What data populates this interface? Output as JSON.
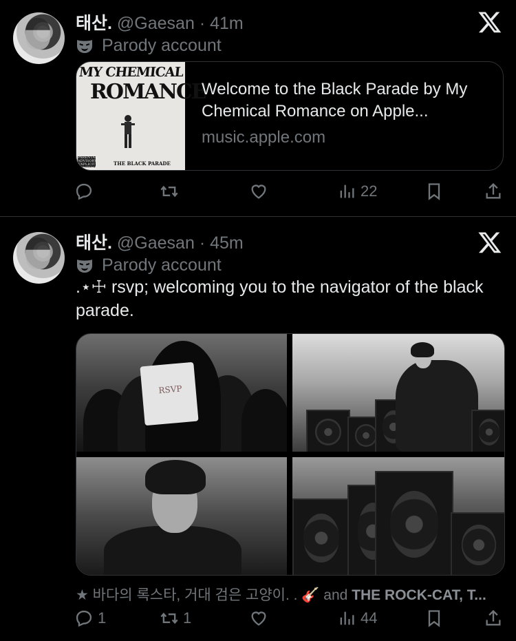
{
  "tweets": [
    {
      "name": "태산.",
      "handle": "@Gaesan",
      "time": "· 41m",
      "badge": "Parody account",
      "link_card": {
        "album_title_top": "MY CHEMICAL",
        "album_title_bottom": "ROMANCE",
        "album_bottom": "THE BLACK PARADE",
        "album_advisory": "PARENTAL ADVISORY EXPLICIT CONTENT",
        "title": "Welcome to the Black Parade by My Chemical Romance on Apple...",
        "domain": "music.apple.com"
      },
      "actions": {
        "replies": "",
        "reposts": "",
        "likes": "",
        "views": "22"
      }
    },
    {
      "name": "태산.",
      "handle": "@Gaesan",
      "time": "· 45m",
      "badge": "Parody account",
      "text": ".⋆☩ rsvp; welcoming you to the navigator of the black parade.",
      "media_note_text": "RSVP",
      "reply_context": {
        "prefix": "★ 바다의 록스타, 거대 검은 고양이. . 🎸 and ",
        "bold": "THE ROCK-CAT, T..."
      },
      "actions": {
        "replies": "1",
        "reposts": "1",
        "likes": "",
        "views": "44"
      }
    }
  ],
  "icons": {
    "platform": "x-logo-icon",
    "badge": "parody-mask-icon",
    "reply": "reply-icon",
    "repost": "repost-icon",
    "like": "heart-icon",
    "views": "views-icon",
    "bookmark": "bookmark-icon",
    "share": "share-icon"
  },
  "colors": {
    "background": "#000000",
    "text": "#e7e9ea",
    "secondary": "#71767b",
    "border": "#2f3336"
  }
}
